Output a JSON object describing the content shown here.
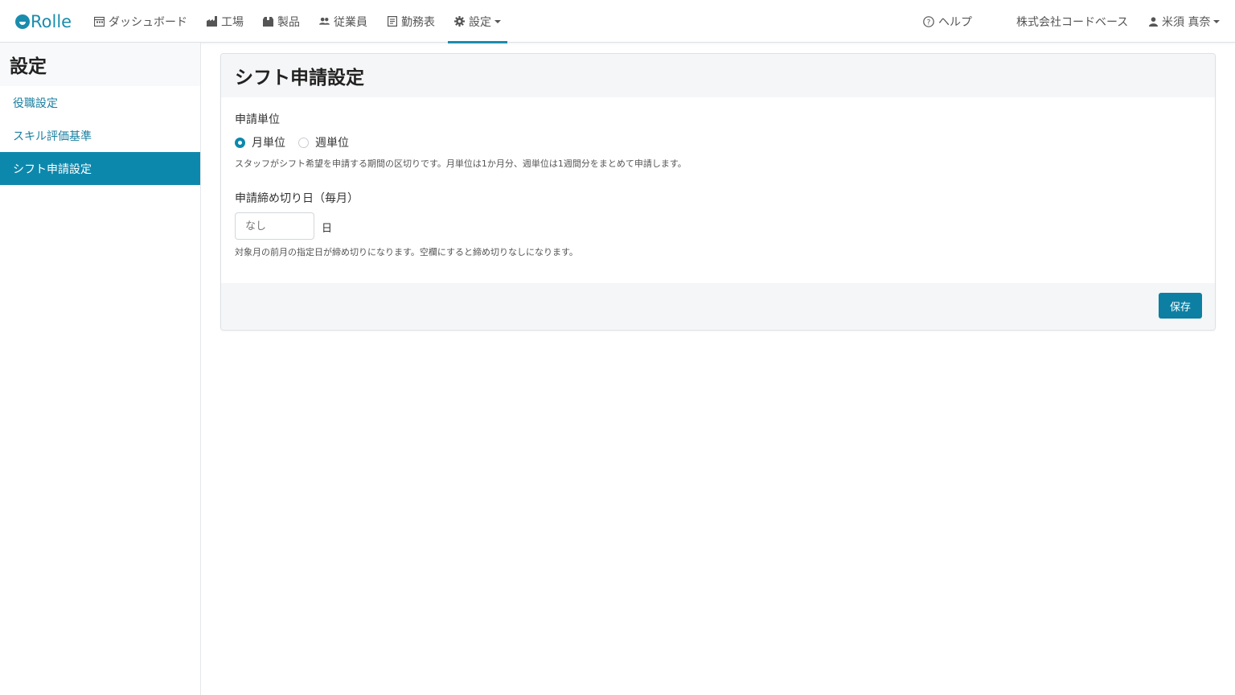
{
  "header": {
    "brand": "Rolle",
    "nav": [
      {
        "label": "ダッシュボード",
        "icon": "calendar-icon"
      },
      {
        "label": "工場",
        "icon": "factory-icon"
      },
      {
        "label": "製品",
        "icon": "box-icon"
      },
      {
        "label": "従業員",
        "icon": "users-icon"
      },
      {
        "label": "勤務表",
        "icon": "document-icon"
      },
      {
        "label": "設定",
        "icon": "gear-icon"
      }
    ],
    "help": "ヘルプ",
    "company": "株式会社コードベース",
    "user": "米須 真奈"
  },
  "sidebar": {
    "title": "設定",
    "items": [
      {
        "label": "役職設定"
      },
      {
        "label": "スキル評価基準"
      },
      {
        "label": "シフト申請設定"
      }
    ]
  },
  "main": {
    "title": "シフト申請設定",
    "unit_label": "申請単位",
    "options": [
      "月単位",
      "週単位"
    ],
    "selected_option": "月単位",
    "unit_help": "スタッフがシフト希望を申請する期間の区切りです。月単位は1か月分、週単位は1週間分をまとめて申請します。",
    "deadline_label": "申請締め切り日（毎月）",
    "deadline_placeholder": "なし",
    "deadline_unit": "日",
    "deadline_help": "対象月の前月の指定日が締め切りになります。空欄にすると締め切りなしになります。",
    "save_label": "保存"
  },
  "colors": {
    "accent": "#0d88ad",
    "link": "#1a7fa0"
  }
}
